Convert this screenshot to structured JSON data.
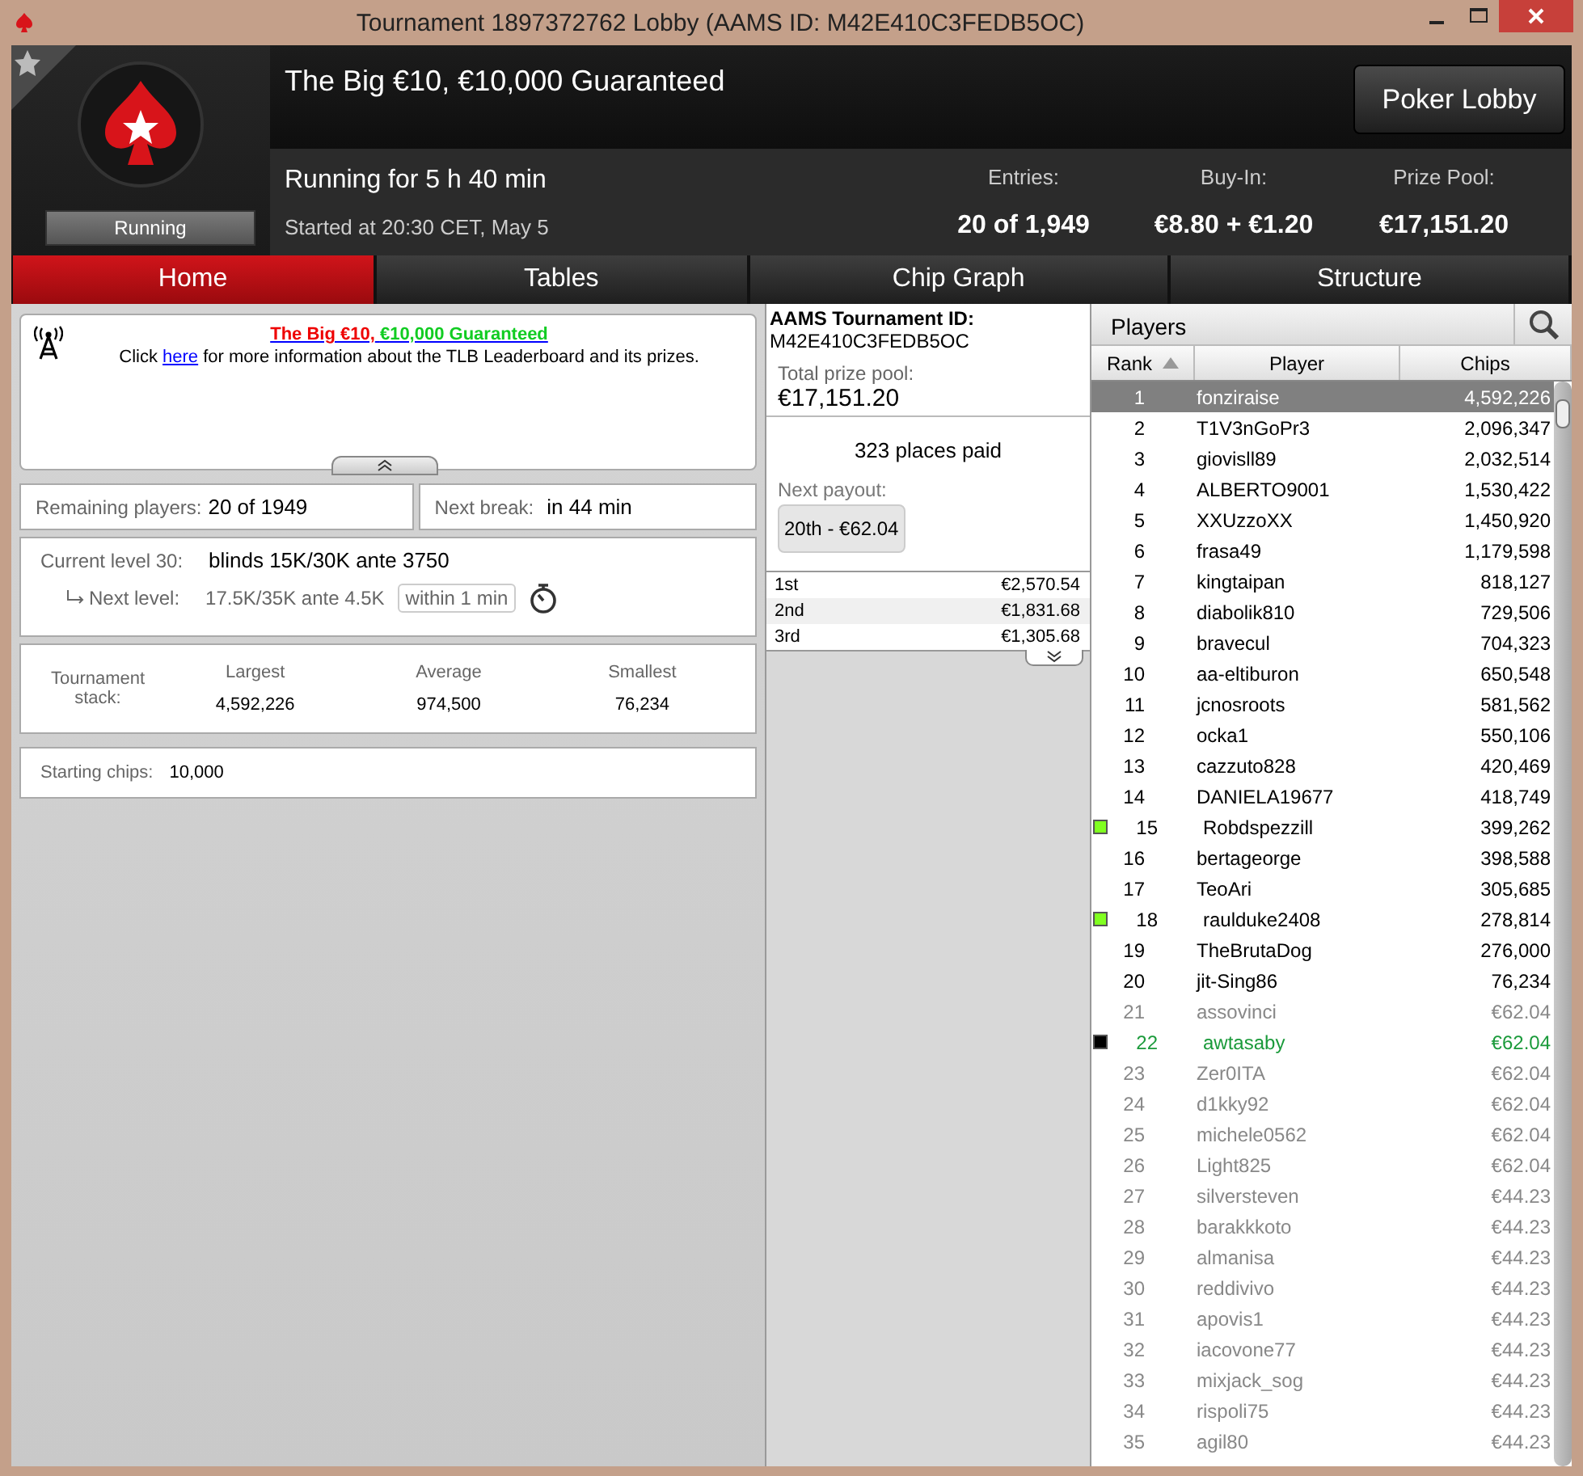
{
  "window": {
    "title": "Tournament 1897372762 Lobby (AAMS ID: M42E410C3FEDB5OC)"
  },
  "header": {
    "name": "The Big €10, €10,000 Guaranteed",
    "status": "Running",
    "running_for": "Running for 5 h 40 min",
    "started": "Started at 20:30 CET, May 5",
    "lobby_button": "Poker Lobby",
    "stats": [
      {
        "label": "Entries:",
        "value": "20 of 1,949"
      },
      {
        "label": "Buy-In:",
        "value": "€8.80 + €1.20"
      },
      {
        "label": "Prize Pool:",
        "value": "€17,151.20"
      }
    ]
  },
  "tabs": [
    {
      "label": "Home",
      "selected": true
    },
    {
      "label": "Tables",
      "selected": false
    },
    {
      "label": "Chip Graph",
      "selected": false
    },
    {
      "label": "Structure",
      "selected": false
    }
  ],
  "news": {
    "title_part_1": "The Big €10,",
    "title_part_2": "€10,000 Guaranteed",
    "text_before": "Click",
    "link": "here",
    "text_after": "for more information about the TLB Leaderboard and its prizes."
  },
  "info": {
    "remaining": {
      "label": "Remaining players:",
      "value": "20 of 1949"
    },
    "next_break": {
      "label": "Next break:",
      "value": "in 44 min"
    },
    "current_level": {
      "label": "Current level 30:",
      "value": "blinds 15K/30K ante 3750"
    },
    "next_level": {
      "label": "Next level:",
      "value": "17.5K/35K ante 4.5K",
      "timer": "within 1 min"
    },
    "stack": {
      "label": "Tournament stack:",
      "columns": [
        {
          "label": "Largest",
          "value": "4,592,226"
        },
        {
          "label": "Average",
          "value": "974,500"
        },
        {
          "label": "Smallest",
          "value": "76,234"
        }
      ]
    },
    "starting_chips": {
      "label": "Starting chips:",
      "value": "10,000"
    }
  },
  "prizes": {
    "aams_label": "AAMS Tournament ID:",
    "aams_id": "M42E410C3FEDB5OC",
    "pool_label": "Total prize pool:",
    "pool": "€17,151.20",
    "places_paid": "323 places paid",
    "next_payout_label": "Next payout:",
    "next_payout": "20th - €62.04",
    "payouts": [
      {
        "place": "1st",
        "amount": "€2,570.54"
      },
      {
        "place": "2nd",
        "amount": "€1,831.68"
      },
      {
        "place": "3rd",
        "amount": "€1,305.68"
      }
    ]
  },
  "players": {
    "title": "Players",
    "columns": [
      {
        "label": "Rank",
        "sorted": true
      },
      {
        "label": "Player",
        "sorted": false
      },
      {
        "label": "Chips",
        "sorted": false
      }
    ],
    "rows": [
      {
        "rank": "1",
        "name": "fonziraise",
        "chips": "4,592,226",
        "kind": "active",
        "selected": true
      },
      {
        "rank": "2",
        "name": "T1V3nGoPr3",
        "chips": "2,096,347",
        "kind": "active",
        "selected": false
      },
      {
        "rank": "3",
        "name": "giovisll89",
        "chips": "2,032,514",
        "kind": "active",
        "selected": false
      },
      {
        "rank": "4",
        "name": "ALBERTO9001",
        "chips": "1,530,422",
        "kind": "active",
        "selected": false
      },
      {
        "rank": "5",
        "name": "XXUzzoXX",
        "chips": "1,450,920",
        "kind": "active",
        "selected": false
      },
      {
        "rank": "6",
        "name": "frasa49",
        "chips": "1,179,598",
        "kind": "active",
        "selected": false
      },
      {
        "rank": "7",
        "name": "kingtaipan",
        "chips": "818,127",
        "kind": "active",
        "selected": false
      },
      {
        "rank": "8",
        "name": "diabolik810",
        "chips": "729,506",
        "kind": "active",
        "selected": false
      },
      {
        "rank": "9",
        "name": "bravecul",
        "chips": "704,323",
        "kind": "active",
        "selected": false
      },
      {
        "rank": "10",
        "name": "aa-eltiburon",
        "chips": "650,548",
        "kind": "active",
        "selected": false
      },
      {
        "rank": "11",
        "name": "jcnosroots",
        "chips": "581,562",
        "kind": "active",
        "selected": false
      },
      {
        "rank": "12",
        "name": "ocka1",
        "chips": "550,106",
        "kind": "active",
        "selected": false
      },
      {
        "rank": "13",
        "name": "cazzuto828",
        "chips": "420,469",
        "kind": "active",
        "selected": false
      },
      {
        "rank": "14",
        "name": "DANIELA19677",
        "chips": "418,749",
        "kind": "active",
        "selected": false
      },
      {
        "rank": "15",
        "name": "Robdspezzill",
        "chips": "399,262",
        "kind": "active",
        "selected": false,
        "color": "#80ff20"
      },
      {
        "rank": "16",
        "name": "bertageorge",
        "chips": "398,588",
        "kind": "active",
        "selected": false
      },
      {
        "rank": "17",
        "name": "TeoAri",
        "chips": "305,685",
        "kind": "active",
        "selected": false
      },
      {
        "rank": "18",
        "name": "raulduke2408",
        "chips": "278,814",
        "kind": "active",
        "selected": false,
        "color": "#80ff20"
      },
      {
        "rank": "19",
        "name": "TheBrutaDog",
        "chips": "276,000",
        "kind": "active",
        "selected": false
      },
      {
        "rank": "20",
        "name": "jit-Sing86",
        "chips": "76,234",
        "kind": "active",
        "selected": false
      },
      {
        "rank": "21",
        "name": "assovinci",
        "chips": "€62.04",
        "kind": "eliminated",
        "selected": false
      },
      {
        "rank": "22",
        "name": "awtasaby",
        "chips": "€62.04",
        "kind": "highlighted",
        "selected": false,
        "color": "#000000"
      },
      {
        "rank": "23",
        "name": "Zer0ITA",
        "chips": "€62.04",
        "kind": "eliminated",
        "selected": false
      },
      {
        "rank": "24",
        "name": "d1kky92",
        "chips": "€62.04",
        "kind": "eliminated",
        "selected": false
      },
      {
        "rank": "25",
        "name": "michele0562",
        "chips": "€62.04",
        "kind": "eliminated",
        "selected": false
      },
      {
        "rank": "26",
        "name": "Light825",
        "chips": "€62.04",
        "kind": "eliminated",
        "selected": false
      },
      {
        "rank": "27",
        "name": "silversteven",
        "chips": "€44.23",
        "kind": "eliminated",
        "selected": false
      },
      {
        "rank": "28",
        "name": "barakkkoto",
        "chips": "€44.23",
        "kind": "eliminated",
        "selected": false
      },
      {
        "rank": "29",
        "name": "almanisa",
        "chips": "€44.23",
        "kind": "eliminated",
        "selected": false
      },
      {
        "rank": "30",
        "name": "reddivivo",
        "chips": "€44.23",
        "kind": "eliminated",
        "selected": false
      },
      {
        "rank": "31",
        "name": "apovis1",
        "chips": "€44.23",
        "kind": "eliminated",
        "selected": false
      },
      {
        "rank": "32",
        "name": "iacovone77",
        "chips": "€44.23",
        "kind": "eliminated",
        "selected": false
      },
      {
        "rank": "33",
        "name": "mixjack_sog",
        "chips": "€44.23",
        "kind": "eliminated",
        "selected": false
      },
      {
        "rank": "34",
        "name": "rispoli75",
        "chips": "€44.23",
        "kind": "eliminated",
        "selected": false
      },
      {
        "rank": "35",
        "name": "agil80",
        "chips": "€44.23",
        "kind": "eliminated",
        "selected": false
      }
    ]
  }
}
